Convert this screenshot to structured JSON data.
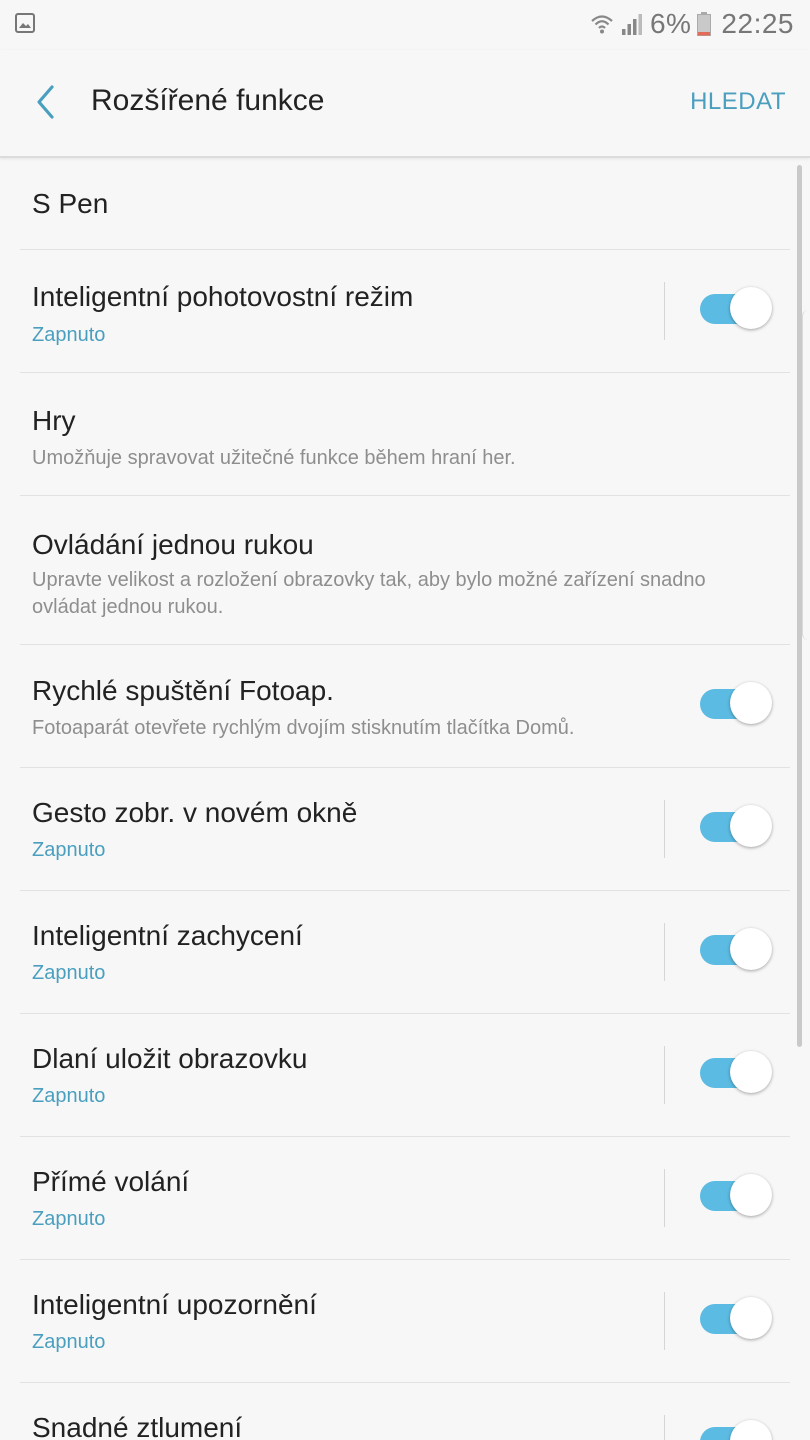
{
  "status_bar": {
    "battery_percent": "6%",
    "time": "22:25",
    "icons": [
      "gallery-icon",
      "wifi-icon",
      "signal-icon",
      "battery-icon"
    ]
  },
  "app_bar": {
    "title": "Rozšířené funkce",
    "search_label": "HLEDAT",
    "back_icon": "chevron-left-icon"
  },
  "colors": {
    "accent": "#4a9fbf",
    "toggle_on": "#5bbbe2",
    "background": "#f7f7f7"
  },
  "items": [
    {
      "title": "S Pen",
      "subtitle": "",
      "toggle": false,
      "toggle_on": false
    },
    {
      "title": "Inteligentní pohotovostní režim",
      "subtitle": "Zapnuto",
      "toggle": true,
      "toggle_on": true
    },
    {
      "title": "Hry",
      "subtitle": "Umožňuje spravovat užitečné funkce během hraní her.",
      "toggle": false,
      "toggle_on": false
    },
    {
      "title": "Ovládání jednou rukou",
      "subtitle": "Upravte velikost a rozložení obrazovky tak, aby bylo možné zařízení snadno ovládat jednou rukou.",
      "toggle": false,
      "toggle_on": false
    },
    {
      "title": "Rychlé spuštění Fotoap.",
      "subtitle": "Fotoaparát otevřete rychlým dvojím stisknutím tlačítka Domů.",
      "toggle": true,
      "toggle_on": true
    },
    {
      "title": "Gesto zobr. v novém okně",
      "subtitle": "Zapnuto",
      "toggle": true,
      "toggle_on": true
    },
    {
      "title": "Inteligentní zachycení",
      "subtitle": "Zapnuto",
      "toggle": true,
      "toggle_on": true
    },
    {
      "title": "Dlaní uložit obrazovku",
      "subtitle": "Zapnuto",
      "toggle": true,
      "toggle_on": true
    },
    {
      "title": "Přímé volání",
      "subtitle": "Zapnuto",
      "toggle": true,
      "toggle_on": true
    },
    {
      "title": "Inteligentní upozornění",
      "subtitle": "Zapnuto",
      "toggle": true,
      "toggle_on": true
    },
    {
      "title": "Snadné ztlumení",
      "subtitle": "",
      "toggle": true,
      "toggle_on": true
    }
  ]
}
